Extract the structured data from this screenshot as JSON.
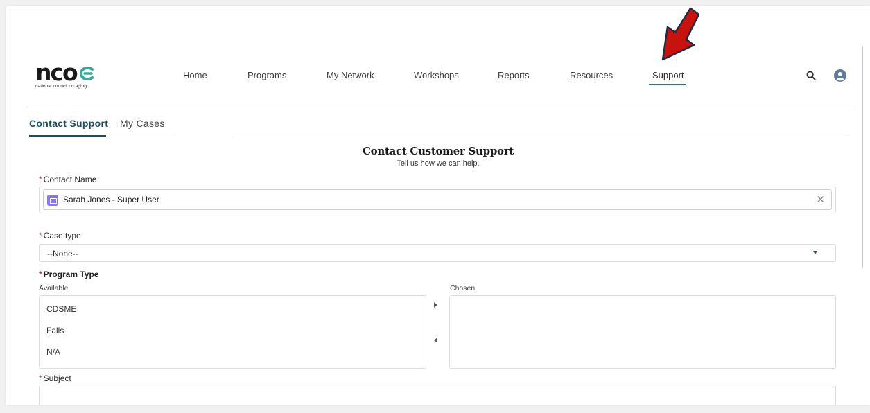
{
  "logo": {
    "wordmark": "nco",
    "tagline": "national council on aging"
  },
  "nav": {
    "items": [
      {
        "label": "Home"
      },
      {
        "label": "Programs"
      },
      {
        "label": "My Network"
      },
      {
        "label": "Workshops"
      },
      {
        "label": "Reports"
      },
      {
        "label": "Resources"
      },
      {
        "label": "Support",
        "active": true
      }
    ],
    "icons": [
      "search-icon",
      "user-avatar-icon"
    ]
  },
  "tabs": [
    {
      "label": "Contact Support",
      "active": true
    },
    {
      "label": "My Cases",
      "active": false
    }
  ],
  "form": {
    "title": "Contact Customer Support",
    "subtitle": "Tell us how we can help.",
    "required_marker": "*",
    "contact_name": {
      "label": "Contact Name",
      "value": "Sarah Jones - Super User",
      "clear_glyph": "✕"
    },
    "case_type": {
      "label": "Case type",
      "value": "--None--"
    },
    "program_type": {
      "label": "Program Type",
      "available_label": "Available",
      "chosen_label": "Chosen",
      "available_options": [
        "CDSME",
        "Falls",
        "N/A"
      ],
      "chosen_options": []
    },
    "subject": {
      "label": "Subject",
      "value": ""
    }
  },
  "colors": {
    "accent": "#1d4f63",
    "nav_underline": "#2f6f80",
    "required": "#c23934",
    "logo_mark": "#3aa89a",
    "lookup_icon": "#8a79e6",
    "annotation_arrow": "#c8120d"
  }
}
